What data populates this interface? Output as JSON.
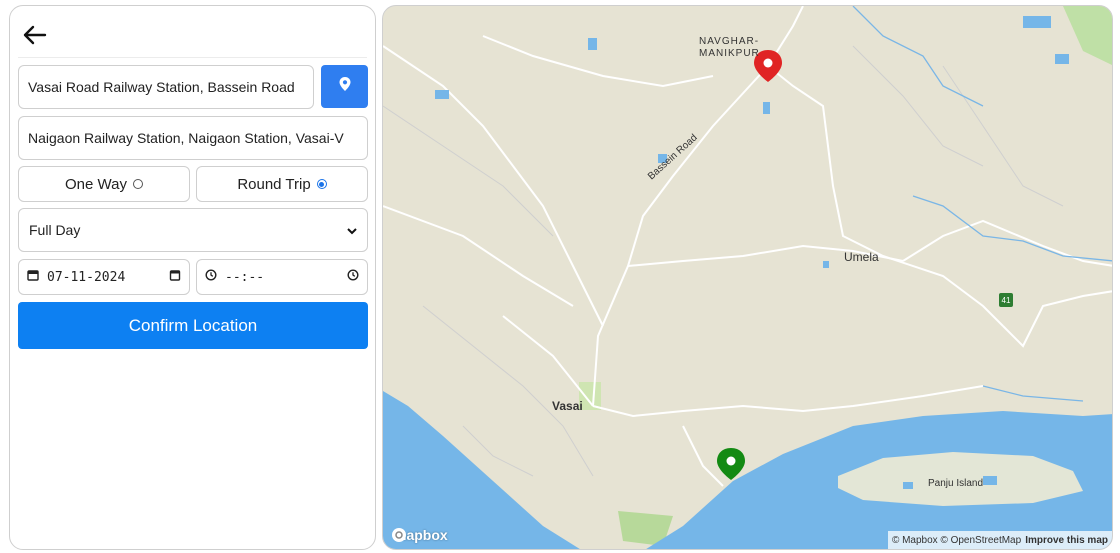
{
  "form": {
    "pickup_value": "Vasai Road Railway Station, Bassein Road",
    "drop_value": "Naigaon Railway Station, Naigaon Station, Vasai-V",
    "trip_options": [
      {
        "label": "One Way",
        "selected": false
      },
      {
        "label": "Round Trip",
        "selected": true
      }
    ],
    "duration_selected": "Full Day",
    "date_value": "07-11-2024",
    "time_value": "--:--",
    "confirm_label": "Confirm Location"
  },
  "icons": {
    "back": "arrow-left-icon",
    "pin": "location-pin-icon",
    "chevron": "chevron-down-icon",
    "calendar": "calendar-icon",
    "clock": "clock-icon"
  },
  "colors": {
    "accent": "#0d80f2",
    "pin_button": "#2f7ef0",
    "start_marker": "#e02424",
    "end_marker": "#138a13",
    "water": "#75b6e8",
    "land": "#e6e3d3"
  },
  "map": {
    "labels": {
      "navghar": "NAVGHAR-",
      "manikpur": "MANIKPUR",
      "bassein_road": "Bassein Road",
      "umela": "Umela",
      "vasai": "Vasai",
      "panju": "Panju Island",
      "route": "41"
    },
    "logo": "mapbox",
    "attribution": "© Mapbox © OpenStreetMap",
    "improve": "Improve this map"
  }
}
